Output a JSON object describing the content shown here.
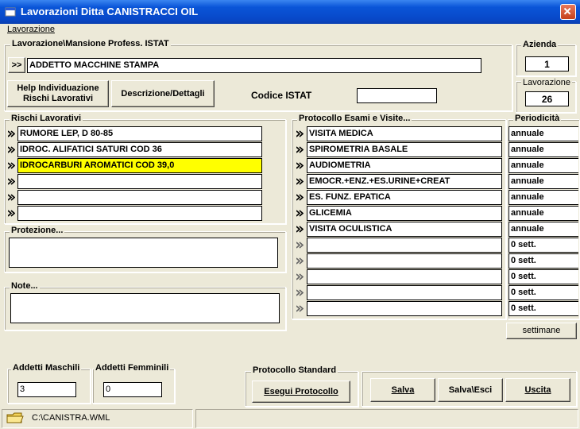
{
  "window": {
    "title": "Lavorazioni Ditta CANISTRACCI OIL"
  },
  "menu": {
    "items": [
      "Lavorazione"
    ]
  },
  "mansione": {
    "legend": "Lavorazione\\Mansione Profess. ISTAT",
    "expand_label": ">>",
    "value": "ADDETTO MACCHINE STAMPA",
    "help_button": "Help Individuazione\nRischi Lavorativi",
    "details_button": "Descrizione/Dettagli",
    "codice_label": "Codice ISTAT",
    "codice_value": ""
  },
  "azienda": {
    "label": "Azienda",
    "value": "1"
  },
  "lavorazione": {
    "label": "Lavorazione",
    "value": "26"
  },
  "rischi": {
    "legend": "Rischi Lavorativi",
    "rows": [
      {
        "text": "RUMORE LEP, D  80-85",
        "highlight": false
      },
      {
        "text": "IDROC. ALIFATICI SATURI COD 36",
        "highlight": false
      },
      {
        "text": "IDROCARBURI AROMATICI COD 39,0",
        "highlight": true
      },
      {
        "text": "",
        "highlight": false
      },
      {
        "text": "",
        "highlight": false
      },
      {
        "text": "",
        "highlight": false
      }
    ]
  },
  "protezione": {
    "legend": "Protezione...",
    "value": ""
  },
  "note": {
    "legend": "Note...",
    "value": ""
  },
  "protocollo": {
    "legend": "Protocollo Esami e Visite...",
    "rows": [
      "VISITA MEDICA",
      "SPIROMETRIA BASALE",
      "AUDIOMETRIA",
      "EMOCR.+ENZ.+ES.URINE+CREAT",
      "ES. FUNZ. EPATICA",
      "GLICEMIA",
      "VISITA OCULISTICA",
      "",
      "",
      "",
      "",
      ""
    ]
  },
  "periodicita": {
    "legend": "Periodicità",
    "rows": [
      "annuale",
      "annuale",
      "annuale",
      "annuale",
      "annuale",
      "annuale",
      "annuale",
      "0 sett.",
      "0 sett.",
      "0 sett.",
      "0 sett.",
      "0 sett."
    ],
    "settimane_button": "settimane"
  },
  "addetti": {
    "maschi_label": "Addetti Maschili",
    "maschi_value": "3",
    "femmine_label": "Addetti Femminili",
    "femmine_value": "0"
  },
  "protocollo_std": {
    "legend": "Protocollo Standard",
    "button": "Esegui Protocollo"
  },
  "actions": {
    "salva": "Salva",
    "salva_esci": "Salva\\Esci",
    "uscita": "Uscita"
  },
  "status": {
    "path": "C:\\CANISTRA.WML"
  },
  "icons": {
    "app": "window-icon",
    "close": "close-icon",
    "arrow": "double-arrow-icon",
    "folder": "folder-icon"
  },
  "colors": {
    "titlebar": "#0a55d8",
    "highlight": "#ffff00",
    "face": "#ece9d8"
  }
}
